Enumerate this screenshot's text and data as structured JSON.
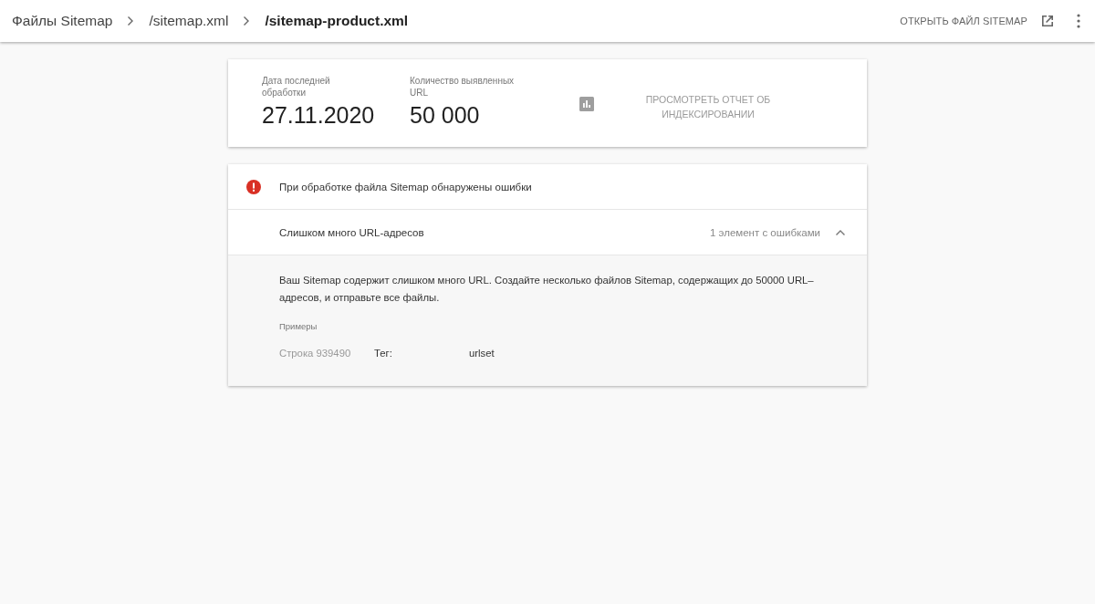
{
  "breadcrumbs": [
    {
      "label": "Файлы Sitemap",
      "selected": false
    },
    {
      "label": "/sitemap.xml",
      "selected": false
    },
    {
      "label": "/sitemap-product.xml",
      "selected": true
    }
  ],
  "header_action": {
    "label": "ОТКРЫТЬ ФАЙЛ SITEMAP"
  },
  "summary": {
    "stats": [
      {
        "label": "Дата последней обработки",
        "value": "27.11.2020"
      },
      {
        "label": "Количество выявленных URL",
        "value": "50 000"
      }
    ],
    "report_link": "ПРОСМОТРЕТЬ ОТЧЕТ ОБ ИНДЕКСИРОВАНИИ"
  },
  "errors": {
    "title": "При обработке файла Sitemap обнаружены ошибки",
    "items": [
      {
        "name": "Слишком много URL-адресов",
        "count": "1 элемент с ошибками",
        "expanded": true,
        "description": "Ваш Sitemap содержит слишком много URL. Создайте несколько файлов Sitemap, содержащих до 50000 URL–адресов, и отправьте все файлы.",
        "examples_label": "Примеры",
        "examples": [
          {
            "line": "Строка 939490",
            "tag_label": "Тег:",
            "tag": "urlset"
          }
        ]
      }
    ]
  }
}
